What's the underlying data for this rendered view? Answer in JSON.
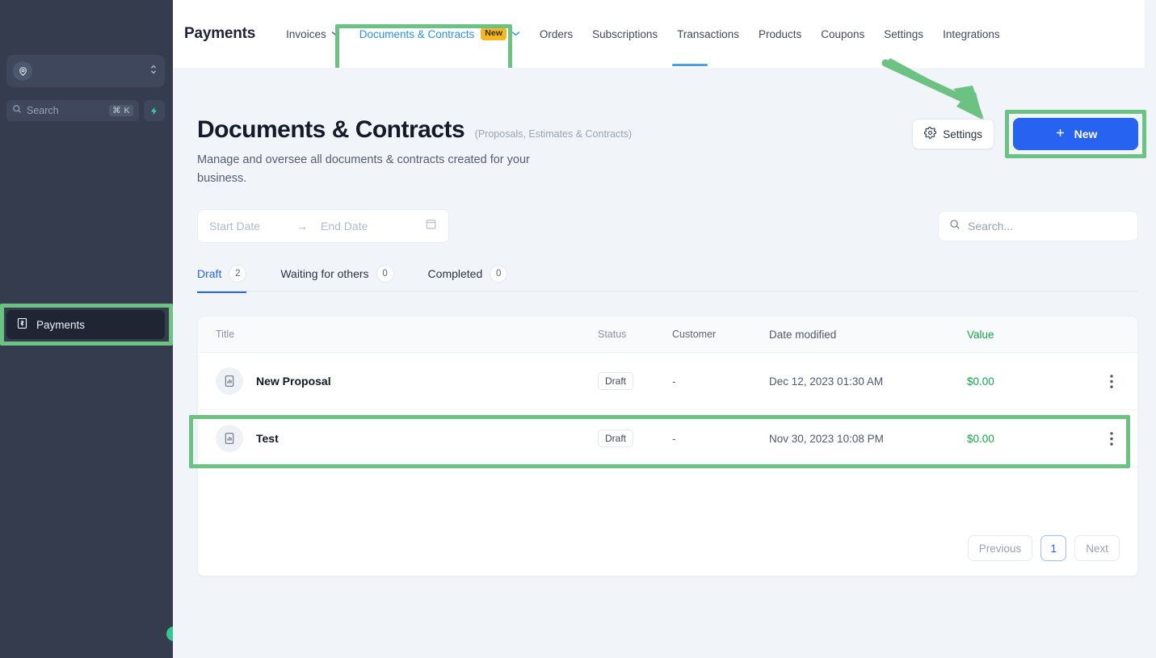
{
  "sidebar": {
    "account": {
      "name": "",
      "icon": "location-pin-icon"
    },
    "search": {
      "placeholder": "Search",
      "shortcut": "⌘ K",
      "bolt_icon": "lightning-bolt-icon"
    },
    "items": [
      {
        "label": "Payments",
        "icon": "money-bill-icon",
        "active": true
      }
    ]
  },
  "topnav": {
    "brand": "Payments",
    "items": [
      {
        "label": "Invoices",
        "has_chevron": true,
        "active": false
      },
      {
        "label": "Documents & Contracts",
        "badge": "New",
        "has_chevron": true,
        "active": true
      },
      {
        "label": "Orders",
        "active": false
      },
      {
        "label": "Subscriptions",
        "active": false
      },
      {
        "label": "Transactions",
        "active": false
      },
      {
        "label": "Products",
        "active": false
      },
      {
        "label": "Coupons",
        "active": false
      },
      {
        "label": "Settings",
        "active": false
      },
      {
        "label": "Integrations",
        "active": false
      }
    ]
  },
  "header": {
    "title": "Documents & Contracts",
    "title_suffix": "(Proposals, Estimates & Contracts)",
    "subtitle": "Manage and oversee all documents & contracts created for your business.",
    "settings_label": "Settings",
    "new_label": "New"
  },
  "filters": {
    "start_date_placeholder": "Start Date",
    "end_date_placeholder": "End Date",
    "range_arrow": "→",
    "search_placeholder": "Search..."
  },
  "tabs": [
    {
      "label": "Draft",
      "count": "2",
      "selected": true
    },
    {
      "label": "Waiting for others",
      "count": "0",
      "selected": false
    },
    {
      "label": "Completed",
      "count": "0",
      "selected": false
    }
  ],
  "table": {
    "columns": [
      "Title",
      "Status",
      "Customer",
      "Date modified",
      "Value"
    ],
    "rows": [
      {
        "title": "New Proposal",
        "status": "Draft",
        "customer": "-",
        "date_modified": "Dec 12, 2023 01:30 AM",
        "value": "$0.00",
        "highlighted": true
      },
      {
        "title": "Test",
        "status": "Draft",
        "customer": "-",
        "date_modified": "Nov 30, 2023 10:08 PM",
        "value": "$0.00",
        "highlighted": false
      }
    ]
  },
  "pagination": {
    "previous": "Previous",
    "page": "1",
    "next": "Next"
  },
  "colors": {
    "accent_blue": "#2563f0",
    "highlight_green": "#6cc283",
    "badge_amber": "#f5b721",
    "value_green": "#16a34a",
    "sidebar_bg": "#343c4e"
  }
}
